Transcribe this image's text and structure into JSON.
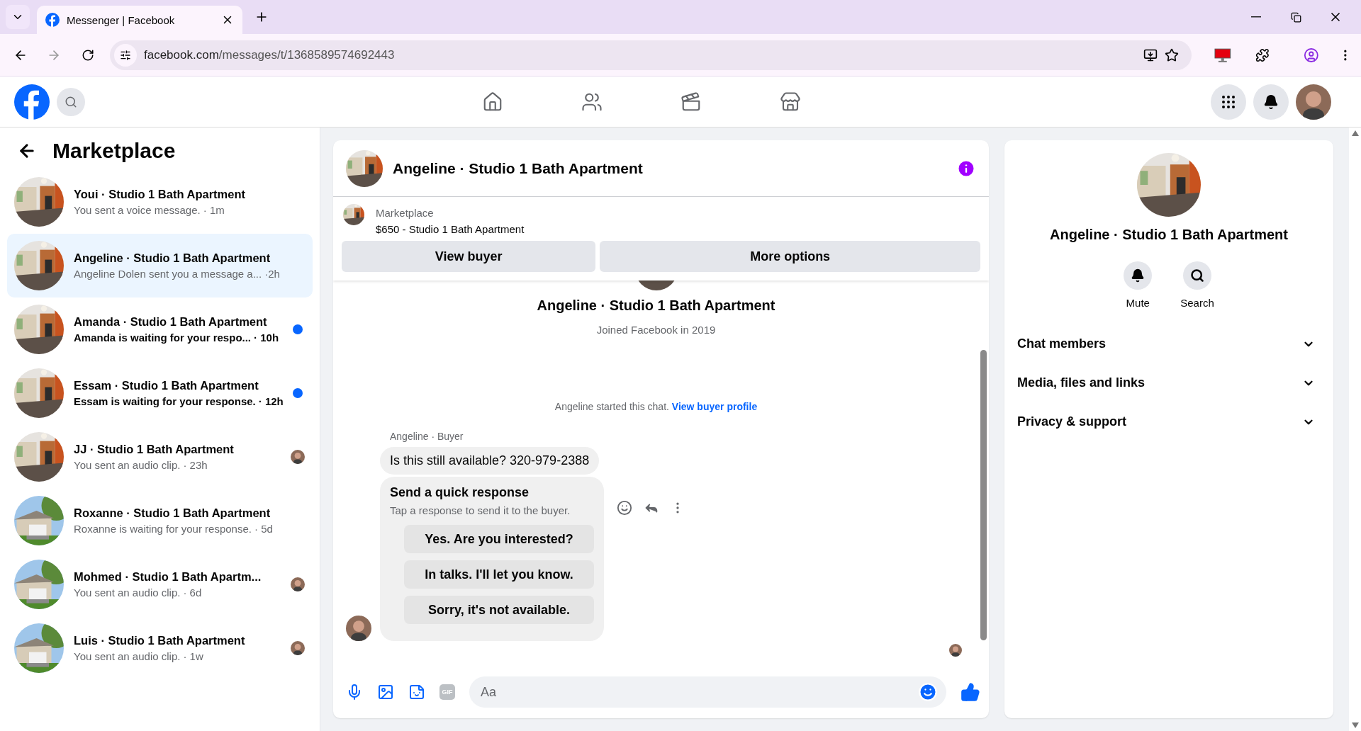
{
  "browser": {
    "tab_title": "Messenger | Facebook",
    "url_domain": "facebook.com",
    "url_path": "/messages/t/1368589574692443"
  },
  "sidebar": {
    "title": "Marketplace",
    "conversations": [
      {
        "name": "Youi · Studio 1 Bath Apartment",
        "preview": "You sent a voice message.",
        "time": "· 1m",
        "selected": false,
        "unread": false,
        "seen": false
      },
      {
        "name": "Angeline · Studio 1 Bath Apartment",
        "preview": "Angeline Dolen sent you a message a...",
        "time": "·2h",
        "selected": true,
        "unread": false,
        "seen": false
      },
      {
        "name": "Amanda · Studio 1 Bath Apartment",
        "preview": "Amanda is waiting for your respo...",
        "time": "· 10h",
        "selected": false,
        "unread": true,
        "seen": false
      },
      {
        "name": "Essam · Studio 1 Bath Apartment",
        "preview": "Essam is waiting for your response.",
        "time": "· 12h",
        "selected": false,
        "unread": true,
        "seen": false
      },
      {
        "name": "JJ · Studio 1 Bath Apartment",
        "preview": "You sent an audio clip.",
        "time": "· 23h",
        "selected": false,
        "unread": false,
        "seen": true
      },
      {
        "name": "Roxanne · Studio 1 Bath Apartment",
        "preview": "Roxanne is waiting for your response.",
        "time": "· 5d",
        "selected": false,
        "unread": false,
        "seen": false
      },
      {
        "name": "Mohmed · Studio 1 Bath Apartm...",
        "preview": "You sent an audio clip.",
        "time": "· 6d",
        "selected": false,
        "unread": false,
        "seen": true
      },
      {
        "name": "Luis · Studio 1 Bath Apartment",
        "preview": "You sent an audio clip.",
        "time": "· 1w",
        "selected": false,
        "unread": false,
        "seen": true
      }
    ]
  },
  "chat": {
    "title": "Angeline · Studio 1 Bath Apartment",
    "listing": {
      "source": "Marketplace",
      "price_title": "$650 - Studio 1 Bath Apartment"
    },
    "actions": [
      "View buyer",
      "More options"
    ],
    "profile": {
      "name": "Angeline · Studio 1 Bath Apartment",
      "joined": "Joined Facebook in 2019"
    },
    "notice": {
      "text": "Angeline started this chat.",
      "link": "View buyer profile"
    },
    "sender_label": "Angeline · Buyer",
    "message": "Is this still available? 320-979-2388",
    "quick_response": {
      "title": "Send a quick response",
      "hint": "Tap a response to send it to the buyer.",
      "options": [
        "Yes. Are you interested?",
        "In talks. I'll let you know.",
        "Sorry, it's not available."
      ]
    },
    "composer": {
      "gif_label": "GIF",
      "placeholder": "Aa"
    }
  },
  "details": {
    "name": "Angeline · Studio 1 Bath Apartment",
    "actions": [
      {
        "label": "Mute",
        "kind": "bell"
      },
      {
        "label": "Search",
        "kind": "search"
      }
    ],
    "sections": [
      {
        "label": "Chat members",
        "expanded": false
      },
      {
        "label": "Media, files and links",
        "expanded": false
      },
      {
        "label": "Privacy & support",
        "expanded": false
      }
    ]
  }
}
